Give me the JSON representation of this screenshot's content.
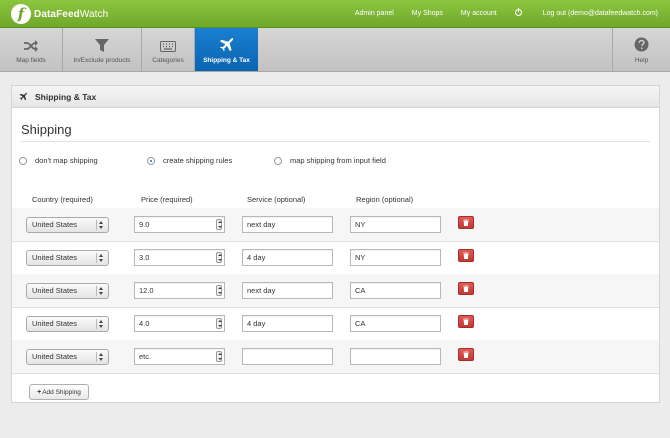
{
  "brand": {
    "name_bold": "DataFeed",
    "name_light": "Watch",
    "logo_letter": "f"
  },
  "topnav": {
    "admin_panel": "Admin panel",
    "my_shops": "My Shops",
    "my_account": "My account",
    "logout": "Log out (demo@datafeedwatch.com)"
  },
  "tabs": [
    {
      "label": "Map fields",
      "icon": "shuffle-icon"
    },
    {
      "label": "In/Exclude products",
      "icon": "filter-icon"
    },
    {
      "label": "Categories",
      "icon": "keyboard-icon"
    },
    {
      "label": "Shipping & Tax",
      "icon": "airplane-icon",
      "active": true
    }
  ],
  "help_tab": {
    "label": "Help",
    "icon": "question-icon"
  },
  "panel": {
    "title": "Shipping & Tax",
    "section_title": "Shipping",
    "options": [
      {
        "label": "don't map shipping",
        "checked": false
      },
      {
        "label": "create shipping rules",
        "checked": true
      },
      {
        "label": "map shipping from input field",
        "checked": false
      }
    ],
    "columns": {
      "country": "Country (required)",
      "price": "Price (required)",
      "service": "Service (optional)",
      "region": "Region (optional)"
    },
    "rows": [
      {
        "country": "United States",
        "price": "9.0",
        "service": "next day",
        "region": "NY"
      },
      {
        "country": "United States",
        "price": "3.0",
        "service": "4 day",
        "region": "NY"
      },
      {
        "country": "United States",
        "price": "12.0",
        "service": "next day",
        "region": "CA"
      },
      {
        "country": "United States",
        "price": "4.0",
        "service": "4 day",
        "region": "CA"
      },
      {
        "country": "United States",
        "price": "etc.",
        "service": "",
        "region": ""
      }
    ],
    "add_button": "Add Shipping"
  },
  "colors": {
    "topbar": "#7cb834",
    "active_tab": "#1172c6",
    "delete": "#d24a45"
  }
}
